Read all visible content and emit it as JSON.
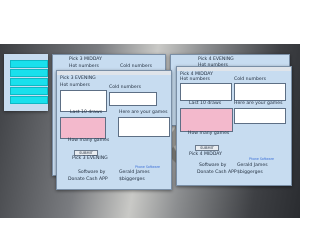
{
  "left_window": {
    "buttons": [
      "",
      "",
      "",
      "",
      ""
    ]
  },
  "win_left": {
    "title": "Pick 3 MIDDAY",
    "hot_label": "Hot numbers",
    "cold_label": "Cold numbers"
  },
  "win_center": {
    "title": "Pick 3 EVENING",
    "hot_label": "Hot numbers",
    "cold_label": "Cold numbers",
    "last_draws_label": "Last 10 draws",
    "games_label": "Here are your games",
    "how_many_label": "How many games",
    "submit_label": "SUBMIT",
    "footer_title": "Pick 3 EVENING",
    "software_by": "Software by",
    "donate": "Donate Cash APP",
    "author": "Gerald James",
    "handle": "$biggerges",
    "link": "Phone Software"
  },
  "win_right_back": {
    "title": "Pick 4 EVENING",
    "hot_label": "Hot numbers"
  },
  "win_right": {
    "title": "Pick 4 MIDDAY",
    "hot_label": "Hot numbers",
    "cold_label": "Cold numbers",
    "last_draws_label": "Last 10 draws",
    "games_label": "Here are your games",
    "how_many_label": "How many games",
    "submit_label": "SUBMIT",
    "footer_title": "Pick 4 MIDDAY",
    "software_by": "Software by",
    "donate": "Donate Cash APP",
    "author": "Gerald James",
    "handle": "$biggerges",
    "link": "Phone Software"
  }
}
